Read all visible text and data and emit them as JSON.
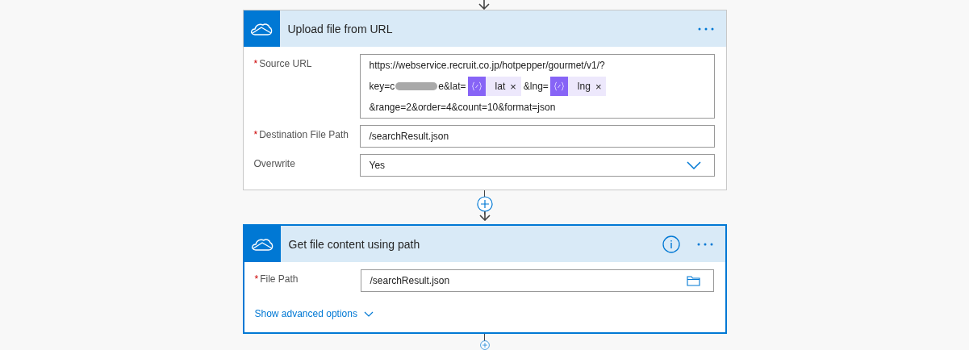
{
  "cards": [
    {
      "title": "Upload file from URL",
      "selected": false,
      "info_icon": false,
      "fields": [
        {
          "kind": "tokens",
          "required_mark": "*",
          "label": "Source URL",
          "lines": [
            [
              {
                "kind": "text",
                "text": "https://webservice.recruit.co.jp/hotpepper/gourmet/v1/?"
              }
            ],
            [
              {
                "kind": "text",
                "text": "key=c"
              },
              {
                "kind": "redacted"
              },
              {
                "kind": "text",
                "text": "e&lat="
              },
              {
                "kind": "token",
                "text": "lat",
                "close": "×"
              },
              {
                "kind": "text",
                "text": "&lng="
              },
              {
                "kind": "token",
                "text": "lng",
                "close": "×"
              }
            ],
            [
              {
                "kind": "text",
                "text": "&range=2&order=4&count=10&format=json"
              }
            ]
          ]
        },
        {
          "kind": "text",
          "required_mark": "*",
          "label": "Destination File Path",
          "value": "/searchResult.json"
        },
        {
          "kind": "dropdown",
          "label": "Overwrite",
          "value": "Yes"
        }
      ]
    },
    {
      "title": "Get file content using path",
      "selected": true,
      "info_icon": true,
      "fields": [
        {
          "kind": "file",
          "required_mark": "*",
          "label": "File Path",
          "value": "/searchResult.json"
        }
      ],
      "advanced_link": "Show advanced options"
    }
  ]
}
